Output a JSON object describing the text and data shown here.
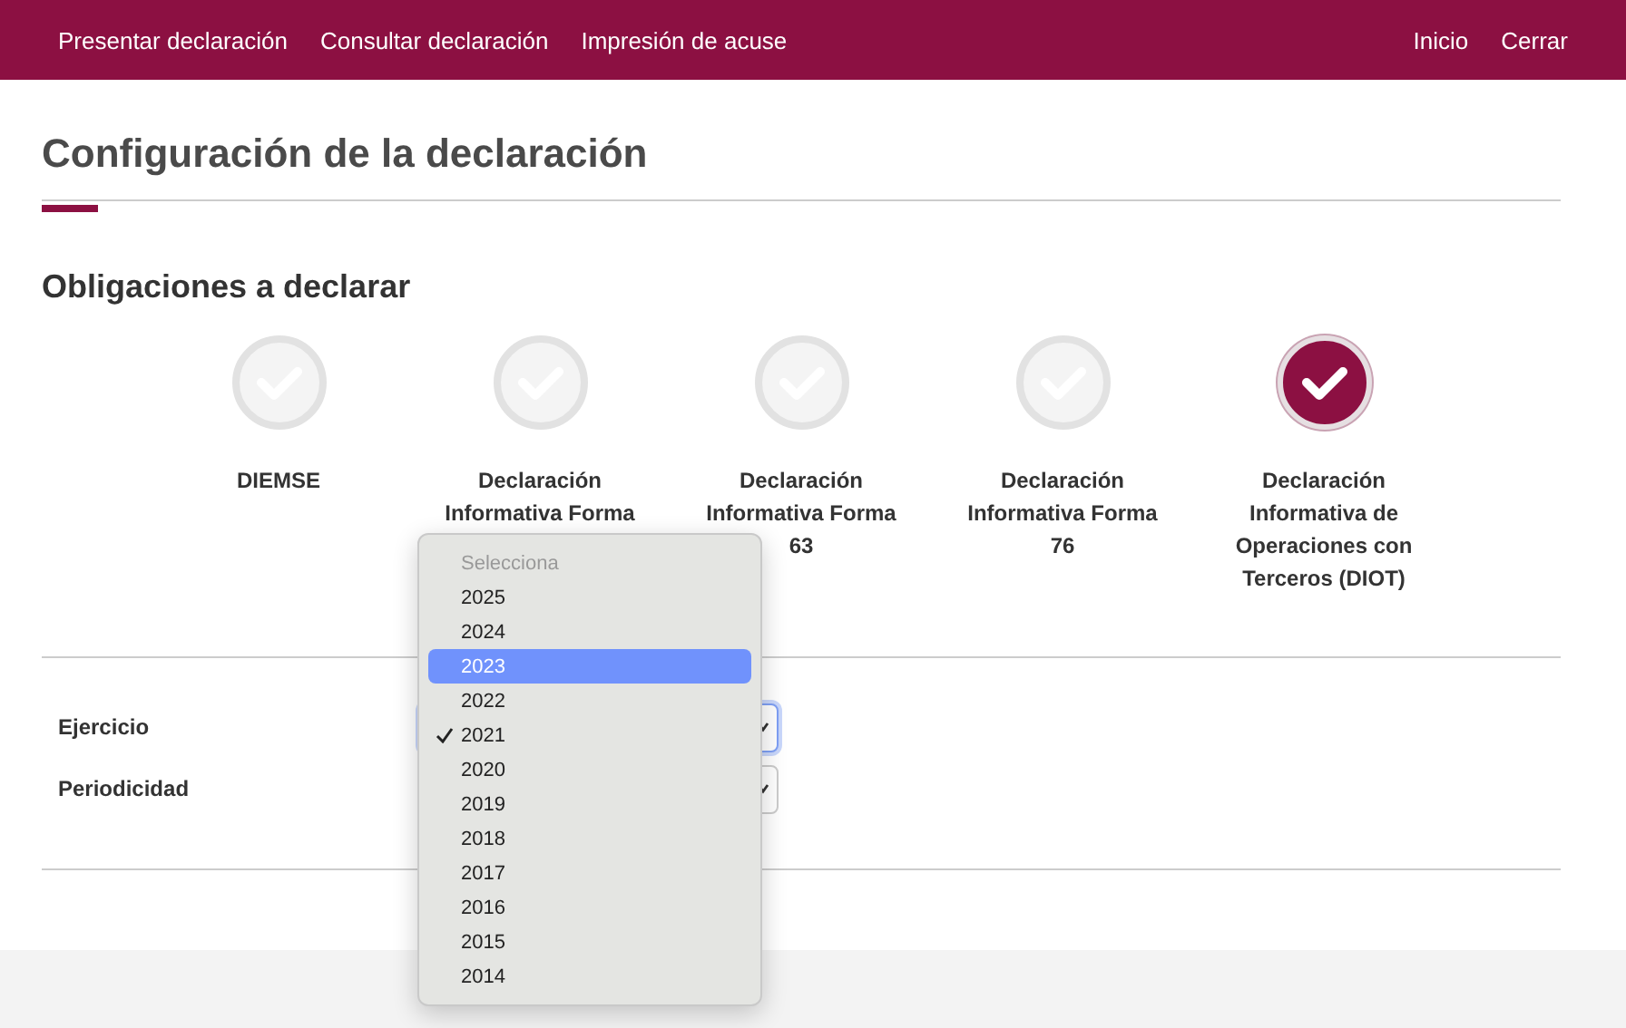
{
  "nav": {
    "left": [
      "Presentar declaración",
      "Consultar declaración",
      "Impresión de acuse"
    ],
    "right": [
      "Inicio",
      "Cerrar"
    ]
  },
  "title": "Configuración de la declaración",
  "section_title": "Obligaciones a declarar",
  "obligations": [
    {
      "label": "DIEMSE",
      "selected": false
    },
    {
      "label": "Declaración Informativa Forma",
      "selected": false
    },
    {
      "label": "Declaración Informativa Forma 63",
      "selected": false
    },
    {
      "label": "Declaración Informativa Forma 76",
      "selected": false
    },
    {
      "label": "Declaración Informativa de Operaciones con Terceros (DIOT)",
      "selected": true
    }
  ],
  "form": [
    {
      "label": "Ejercicio",
      "focused": true
    },
    {
      "label": "Periodicidad",
      "focused": false
    }
  ],
  "dropdown": [
    {
      "label": "Selecciona",
      "kind": "placeholder",
      "selected": false,
      "checked": false
    },
    {
      "label": "2025",
      "kind": "option",
      "selected": false,
      "checked": false
    },
    {
      "label": "2024",
      "kind": "option",
      "selected": false,
      "checked": false
    },
    {
      "label": "2023",
      "kind": "option",
      "selected": true,
      "checked": false
    },
    {
      "label": "2022",
      "kind": "option",
      "selected": false,
      "checked": false
    },
    {
      "label": "2021",
      "kind": "option",
      "selected": false,
      "checked": true
    },
    {
      "label": "2020",
      "kind": "option",
      "selected": false,
      "checked": false
    },
    {
      "label": "2019",
      "kind": "option",
      "selected": false,
      "checked": false
    },
    {
      "label": "2018",
      "kind": "option",
      "selected": false,
      "checked": false
    },
    {
      "label": "2017",
      "kind": "option",
      "selected": false,
      "checked": false
    },
    {
      "label": "2016",
      "kind": "option",
      "selected": false,
      "checked": false
    },
    {
      "label": "2015",
      "kind": "option",
      "selected": false,
      "checked": false
    },
    {
      "label": "2014",
      "kind": "option",
      "selected": false,
      "checked": false
    }
  ]
}
